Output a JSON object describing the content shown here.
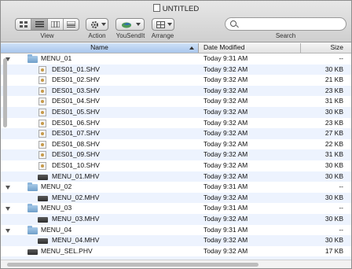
{
  "window": {
    "title": "UNTITLED"
  },
  "toolbar": {
    "view_label": "View",
    "action_label": "Action",
    "yousendit_label": "YouSendIt",
    "arrange_label": "Arrange",
    "search_label": "Search",
    "search_placeholder": ""
  },
  "columns": {
    "name": "Name",
    "date": "Date Modified",
    "size": "Size"
  },
  "rows": [
    {
      "name": "MENU_01",
      "date": "Today 9:31 AM",
      "size": "--",
      "kind": "folder",
      "indent": 0
    },
    {
      "name": "DES01_01.SHV",
      "date": "Today 9:32 AM",
      "size": "30 KB",
      "kind": "image",
      "indent": 1
    },
    {
      "name": "DES01_02.SHV",
      "date": "Today 9:32 AM",
      "size": "21 KB",
      "kind": "image",
      "indent": 1
    },
    {
      "name": "DES01_03.SHV",
      "date": "Today 9:32 AM",
      "size": "23 KB",
      "kind": "image",
      "indent": 1
    },
    {
      "name": "DES01_04.SHV",
      "date": "Today 9:32 AM",
      "size": "31 KB",
      "kind": "image",
      "indent": 1
    },
    {
      "name": "DES01_05.SHV",
      "date": "Today 9:32 AM",
      "size": "30 KB",
      "kind": "image",
      "indent": 1
    },
    {
      "name": "DES01_06.SHV",
      "date": "Today 9:32 AM",
      "size": "23 KB",
      "kind": "image",
      "indent": 1
    },
    {
      "name": "DES01_07.SHV",
      "date": "Today 9:32 AM",
      "size": "27 KB",
      "kind": "image",
      "indent": 1
    },
    {
      "name": "DES01_08.SHV",
      "date": "Today 9:32 AM",
      "size": "22 KB",
      "kind": "image",
      "indent": 1
    },
    {
      "name": "DES01_09.SHV",
      "date": "Today 9:32 AM",
      "size": "31 KB",
      "kind": "image",
      "indent": 1
    },
    {
      "name": "DES01_10.SHV",
      "date": "Today 9:32 AM",
      "size": "30 KB",
      "kind": "image",
      "indent": 1
    },
    {
      "name": "MENU_01.MHV",
      "date": "Today 9:32 AM",
      "size": "30 KB",
      "kind": "file",
      "indent": 1
    },
    {
      "name": "MENU_02",
      "date": "Today 9:31 AM",
      "size": "--",
      "kind": "folder",
      "indent": 0
    },
    {
      "name": "MENU_02.MHV",
      "date": "Today 9:32 AM",
      "size": "30 KB",
      "kind": "file",
      "indent": 1
    },
    {
      "name": "MENU_03",
      "date": "Today 9:31 AM",
      "size": "--",
      "kind": "folder",
      "indent": 0
    },
    {
      "name": "MENU_03.MHV",
      "date": "Today 9:32 AM",
      "size": "30 KB",
      "kind": "file",
      "indent": 1
    },
    {
      "name": "MENU_04",
      "date": "Today 9:31 AM",
      "size": "--",
      "kind": "folder",
      "indent": 0
    },
    {
      "name": "MENU_04.MHV",
      "date": "Today 9:32 AM",
      "size": "30 KB",
      "kind": "file",
      "indent": 1
    },
    {
      "name": "MENU_SEL.PHV",
      "date": "Today 9:32 AM",
      "size": "17 KB",
      "kind": "file",
      "indent": 0
    },
    {
      "name": "",
      "date": "",
      "size": "",
      "kind": "",
      "indent": 0
    }
  ],
  "colors": {
    "header_selected": "#a9c6ec",
    "stripe": "#edf3fe"
  }
}
